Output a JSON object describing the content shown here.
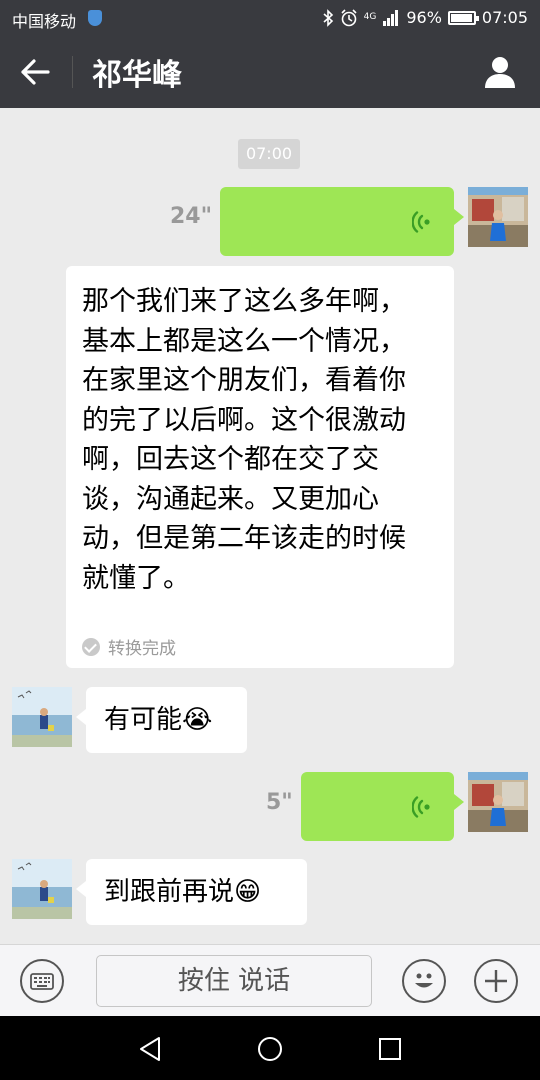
{
  "status_bar": {
    "carrier": "中国移动",
    "network": "4G",
    "battery_percent": "96%",
    "battery_level": 0.96,
    "time": "07:05"
  },
  "header": {
    "title": "祁华峰",
    "back_icon": "arrow-left-icon",
    "profile_icon": "person-icon"
  },
  "chat": {
    "timestamp": "07:00",
    "messages": [
      {
        "from": "me",
        "type": "voice",
        "duration": "24\""
      },
      {
        "from": "me",
        "type": "transcript",
        "text": "那个我们来了这么多年啊，基本上都是这么一个情况，在家里这个朋友们，看着你的完了以后啊。这个很激动啊，回去这个都在交了交谈，沟通起来。又更加心动，但是第二年该走的时候就懂了。",
        "status": "转换完成"
      },
      {
        "from": "them",
        "type": "text",
        "text": "有可能",
        "emoji": "😭"
      },
      {
        "from": "me",
        "type": "voice",
        "duration": "5\""
      },
      {
        "from": "them",
        "type": "text",
        "text": "到跟前再说",
        "emoji": "😁"
      }
    ]
  },
  "input_bar": {
    "hold_to_talk_label": "按住 说话",
    "keyboard_icon": "keyboard-icon",
    "emoji_icon": "smiley-icon",
    "more_icon": "plus-icon"
  },
  "colors": {
    "header_bg": "#393a3f",
    "chat_bg": "#ebebeb",
    "voice_bubble": "#9ee655",
    "voice_wave": "#3a9e25"
  }
}
